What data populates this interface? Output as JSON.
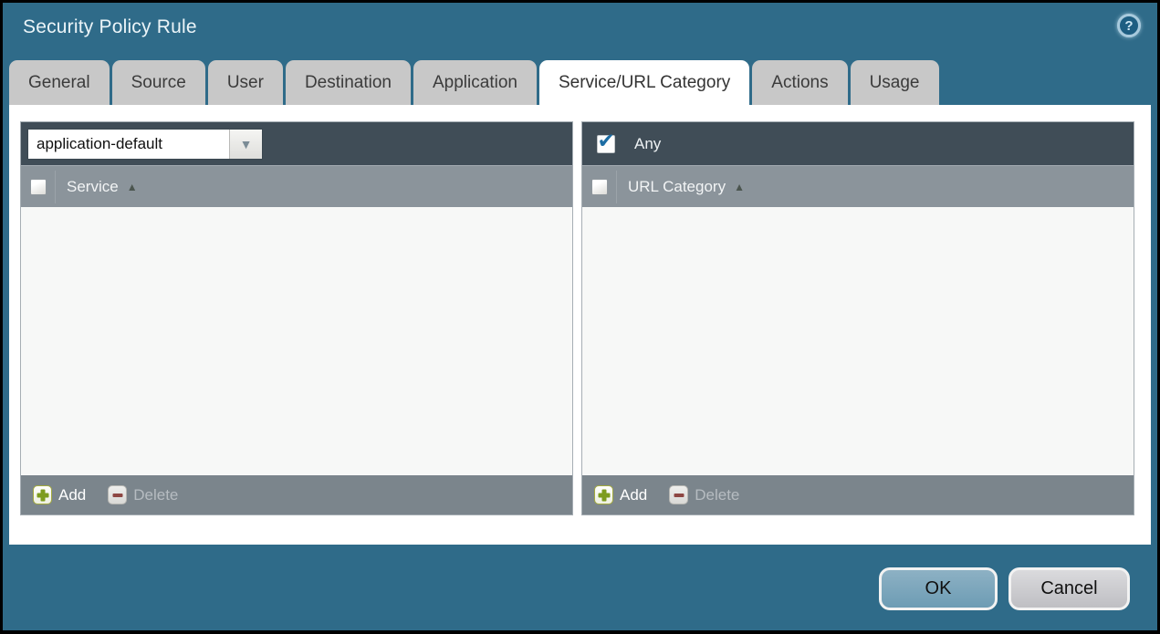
{
  "window": {
    "title": "Security Policy Rule"
  },
  "icons": {
    "help": "?",
    "check": "✔",
    "sort_asc": "▲",
    "dropdown_arrow": "▼"
  },
  "tabs": [
    {
      "label": "General",
      "active": false
    },
    {
      "label": "Source",
      "active": false
    },
    {
      "label": "User",
      "active": false
    },
    {
      "label": "Destination",
      "active": false
    },
    {
      "label": "Application",
      "active": false
    },
    {
      "label": "Service/URL Category",
      "active": true
    },
    {
      "label": "Actions",
      "active": false
    },
    {
      "label": "Usage",
      "active": false
    }
  ],
  "service_panel": {
    "dropdown": {
      "value": "application-default"
    },
    "header": {
      "label": "Service",
      "sort": "asc",
      "checkbox_checked": false
    },
    "rows": [],
    "toolbar": {
      "add_label": "Add",
      "delete_label": "Delete",
      "delete_enabled": false
    }
  },
  "url_category_panel": {
    "any": {
      "label": "Any",
      "checked": true
    },
    "header": {
      "label": "URL Category",
      "sort": "asc",
      "checkbox_checked": false
    },
    "rows": [],
    "toolbar": {
      "add_label": "Add",
      "delete_label": "Delete",
      "delete_enabled": false
    }
  },
  "footer": {
    "ok_label": "OK",
    "cancel_label": "Cancel"
  },
  "colors": {
    "background_teal": "#2f6b89",
    "panel_header_dark": "#404d57",
    "column_header_gray": "#8b949b",
    "toolbar_gray": "#7b858c",
    "tab_gray": "#c8c8c8",
    "active_tab_white": "#ffffff",
    "body_offwhite": "#f7f8f7",
    "ok_button_blue": "#7ca6bb",
    "cancel_button_gray": "#c9c9cd",
    "add_icon_green": "#7d9c1e",
    "delete_icon_red": "#8e4743",
    "check_blue": "#1b6ca3"
  }
}
